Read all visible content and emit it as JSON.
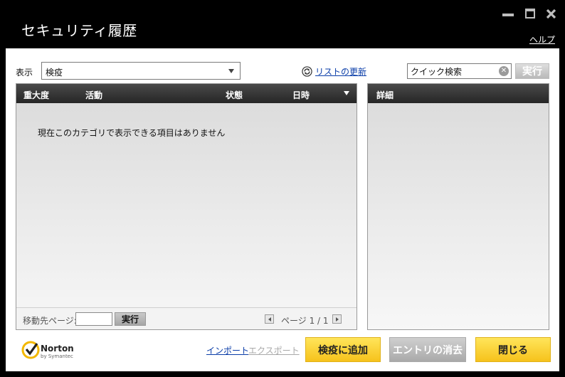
{
  "window": {
    "title": "セキュリティ履歴",
    "help_label": "ヘルプ"
  },
  "filter": {
    "label": "表示",
    "selected": "検疫"
  },
  "refresh_label": "リストの更新",
  "search": {
    "placeholder": "クイック検索",
    "value": "クイック検索",
    "run_label": "実行"
  },
  "list": {
    "columns": [
      "重大度",
      "活動",
      "状態",
      "日時"
    ],
    "empty_message": "現在このカテゴリで表示できる項目はありません"
  },
  "details": {
    "header": "詳細"
  },
  "pager": {
    "goto_label": "移動先ページ:",
    "run_label": "実行",
    "page_text": "ページ 1 / 1"
  },
  "footer": {
    "brand": "Norton",
    "brand_sub": "by Symantec",
    "import_label": "インポート",
    "export_label": "エクスポート",
    "add_quarantine_label": "検疫に追加",
    "delete_entry_label": "エントリの消去",
    "close_label": "閉じる"
  },
  "colors": {
    "accent_yellow": "#f6c21c",
    "titlebar": "#000000",
    "header_dark": "#2e2e2e",
    "link": "#0a3da8"
  }
}
